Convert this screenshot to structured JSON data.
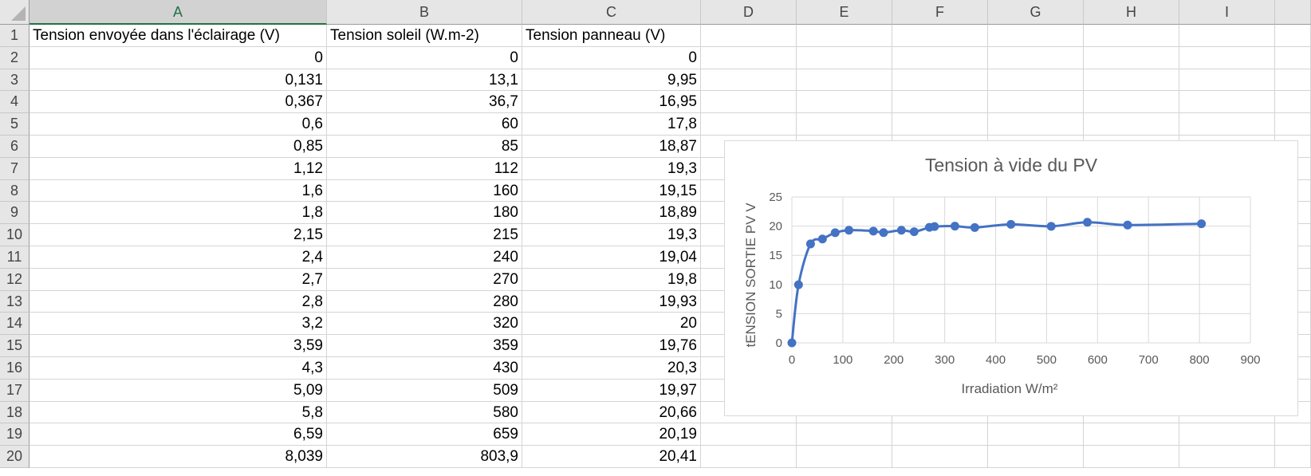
{
  "columns": [
    "A",
    "B",
    "C",
    "D",
    "E",
    "F",
    "G",
    "H",
    "I"
  ],
  "rows": [
    "1",
    "2",
    "3",
    "4",
    "5",
    "6",
    "7",
    "8",
    "9",
    "10",
    "11",
    "12",
    "13",
    "14",
    "15",
    "16",
    "17",
    "18",
    "19",
    "20"
  ],
  "headers": [
    "Tension envoyée dans l'éclairage (V)",
    "Tension soleil (W.m-2)",
    "Tension panneau (V)"
  ],
  "table": [
    [
      "0",
      "0",
      "0"
    ],
    [
      "0,131",
      "13,1",
      "9,95"
    ],
    [
      "0,367",
      "36,7",
      "16,95"
    ],
    [
      "0,6",
      "60",
      "17,8"
    ],
    [
      "0,85",
      "85",
      "18,87"
    ],
    [
      "1,12",
      "112",
      "19,3"
    ],
    [
      "1,6",
      "160",
      "19,15"
    ],
    [
      "1,8",
      "180",
      "18,89"
    ],
    [
      "2,15",
      "215",
      "19,3"
    ],
    [
      "2,4",
      "240",
      "19,04"
    ],
    [
      "2,7",
      "270",
      "19,8"
    ],
    [
      "2,8",
      "280",
      "19,93"
    ],
    [
      "3,2",
      "320",
      "20"
    ],
    [
      "3,59",
      "359",
      "19,76"
    ],
    [
      "4,3",
      "430",
      "20,3"
    ],
    [
      "5,09",
      "509",
      "19,97"
    ],
    [
      "5,8",
      "580",
      "20,66"
    ],
    [
      "6,59",
      "659",
      "20,19"
    ],
    [
      "8,039",
      "803,9",
      "20,41"
    ]
  ],
  "colors": {
    "series": "#4472c4",
    "selected_header": "#217346",
    "grid": "#d9d9d9"
  },
  "chart_data": {
    "type": "scatter",
    "title": "Tension à vide du PV",
    "xlabel": "Irradiation W/m²",
    "ylabel": "tENSION SORTIE PV V",
    "xlim": [
      0,
      900
    ],
    "ylim": [
      0,
      25
    ],
    "xticks": [
      "0",
      "100",
      "200",
      "300",
      "400",
      "500",
      "600",
      "700",
      "800",
      "900"
    ],
    "yticks": [
      "0",
      "5",
      "10",
      "15",
      "20",
      "25"
    ],
    "grid": true,
    "smooth_lines": true,
    "markers": true,
    "series": [
      {
        "x": [
          0,
          13.1,
          36.7,
          60,
          85,
          112,
          160,
          180,
          215,
          240,
          270,
          280,
          320,
          359,
          430,
          509,
          580,
          659,
          803.9
        ],
        "y": [
          0,
          9.95,
          16.95,
          17.8,
          18.87,
          19.3,
          19.15,
          18.89,
          19.3,
          19.04,
          19.8,
          19.93,
          20,
          19.76,
          20.3,
          19.97,
          20.66,
          20.19,
          20.41
        ]
      }
    ]
  }
}
